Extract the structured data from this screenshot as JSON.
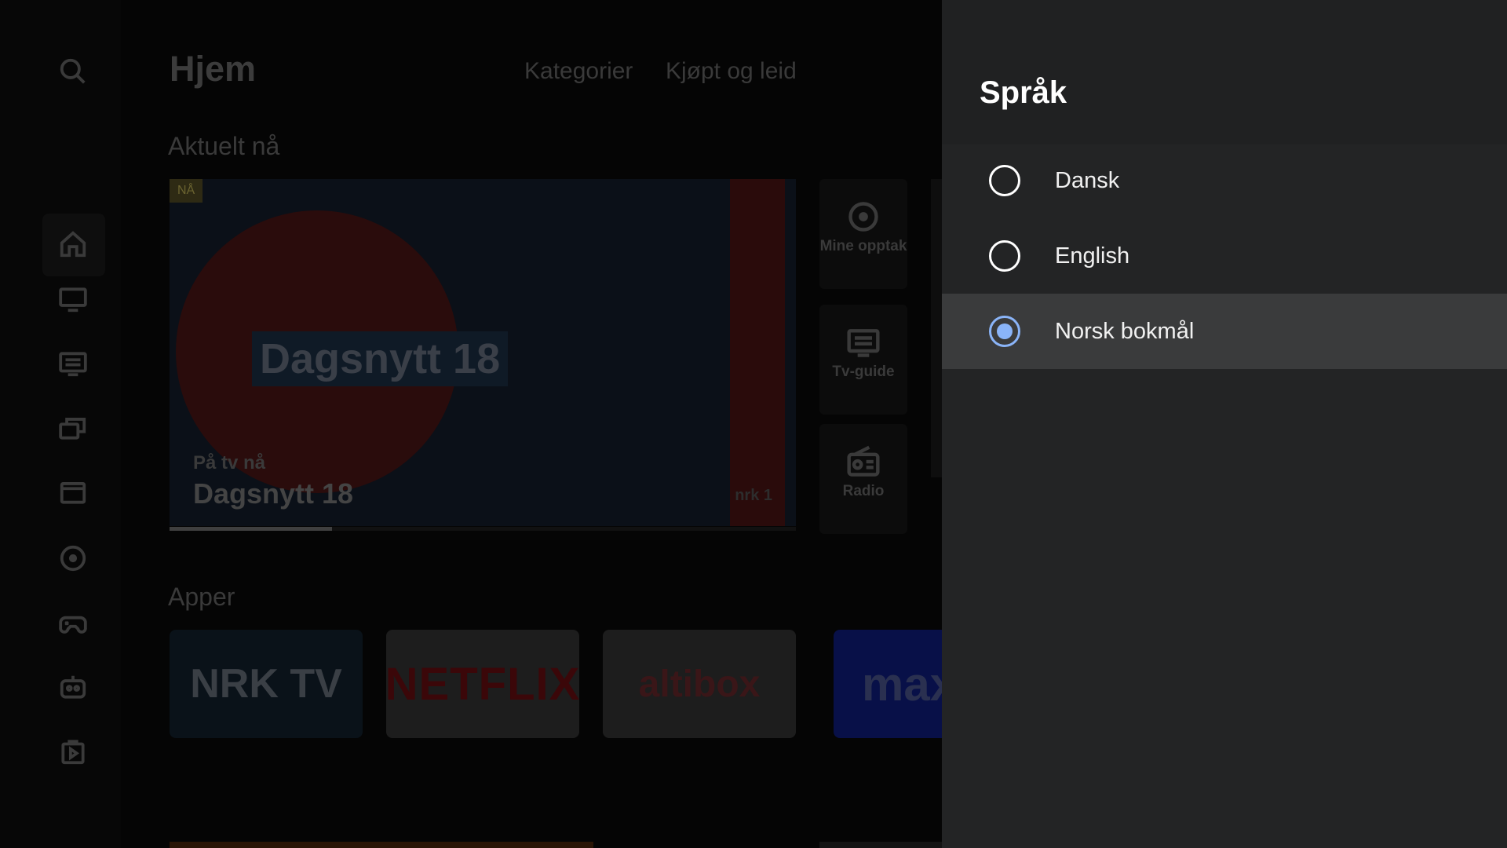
{
  "home": {
    "title": "Hjem",
    "nav": [
      "Kategorier",
      "Kjøpt og leid"
    ],
    "section_now": "Aktuelt nå",
    "section_apps": "Apper",
    "hero": {
      "badge": "NÅ",
      "logo_text": "Dagsnytt 18",
      "subtitle": "På tv nå",
      "program": "Dagsnytt 18",
      "channel": "nrk 1",
      "progress": 0.26
    },
    "tiles": [
      {
        "label": "Mine opptak",
        "icon": "record-icon"
      },
      {
        "label": "Tv-guide",
        "icon": "tv-guide-icon"
      },
      {
        "label": "Radio",
        "icon": "radio-icon"
      }
    ],
    "apps": [
      {
        "label": "NRK TV"
      },
      {
        "label": "NETFLIX"
      },
      {
        "label": "altibox"
      },
      {
        "label": "max"
      }
    ]
  },
  "dialog": {
    "title": "Språk",
    "options": [
      {
        "label": "Dansk",
        "selected": false
      },
      {
        "label": "English",
        "selected": false
      },
      {
        "label": "Norsk bokmål",
        "selected": true
      }
    ],
    "accent": "#8ab4f8"
  }
}
